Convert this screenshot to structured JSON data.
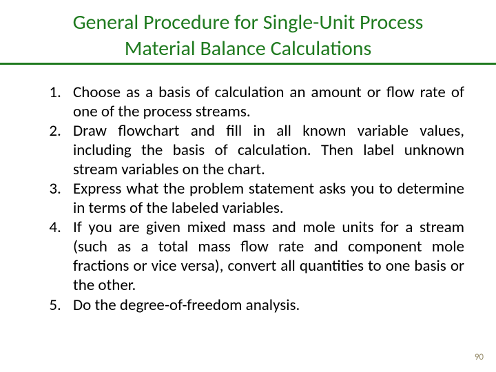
{
  "title": {
    "line1": "General Procedure for Single-Unit Process",
    "line2": "Material Balance Calculations"
  },
  "steps": [
    "Choose as a basis of calculation an amount or flow rate of one of the process streams.",
    "Draw flowchart and fill in all known variable values, including the basis of calculation. Then label unknown stream variables on the chart.",
    "Express what the problem statement asks you to determine in terms of the labeled variables.",
    "If you are given mixed mass and mole units for a stream (such as a total mass flow rate and component mole fractions or vice versa), convert all quantities to one basis or the other.",
    "Do the degree-of-freedom analysis."
  ],
  "page_number": "90"
}
